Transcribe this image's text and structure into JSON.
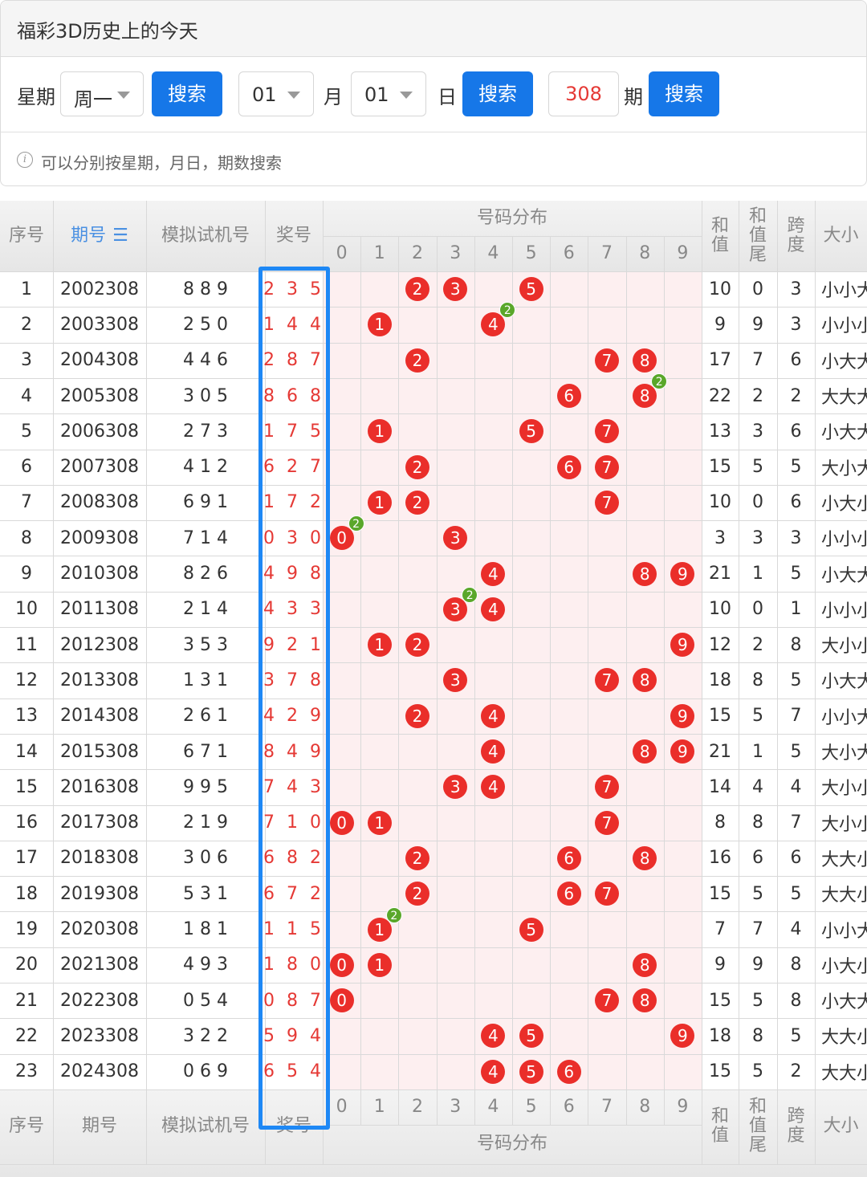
{
  "page": {
    "title": "福彩3D历史上的今天"
  },
  "search": {
    "weekday_label": "星期",
    "weekday_value": "周一",
    "search_button_1": "搜索",
    "month_value": "01",
    "month_label": "月",
    "day_value": "01",
    "day_label": "日",
    "search_button_2": "搜索",
    "issue_value": "308",
    "issue_label": "期",
    "search_button_3": "搜索"
  },
  "hint": "可以分别按星期，月日，期数搜索",
  "table": {
    "headers": {
      "seq": "序号",
      "issue": "期号",
      "trial": "模拟试机号",
      "prize": "奖号",
      "distribution": "号码分布",
      "sum": "和\n值",
      "sum_tail": "和\n值\n尾",
      "span": "跨\n度",
      "size": "大小"
    },
    "digits": [
      "0",
      "1",
      "2",
      "3",
      "4",
      "5",
      "6",
      "7",
      "8",
      "9"
    ],
    "rows": [
      {
        "seq": "1",
        "issue": "2002308",
        "trial": "8 8 9",
        "prize": "2 3 5",
        "sum": "10",
        "tail": "0",
        "span": "3",
        "size": "小小大"
      },
      {
        "seq": "2",
        "issue": "2003308",
        "trial": "2 5 0",
        "prize": "1 4 4",
        "sum": "9",
        "tail": "9",
        "span": "3",
        "size": "小小小"
      },
      {
        "seq": "3",
        "issue": "2004308",
        "trial": "4 4 6",
        "prize": "2 8 7",
        "sum": "17",
        "tail": "7",
        "span": "6",
        "size": "小大大"
      },
      {
        "seq": "4",
        "issue": "2005308",
        "trial": "3 0 5",
        "prize": "8 6 8",
        "sum": "22",
        "tail": "2",
        "span": "2",
        "size": "大大大"
      },
      {
        "seq": "5",
        "issue": "2006308",
        "trial": "2 7 3",
        "prize": "1 7 5",
        "sum": "13",
        "tail": "3",
        "span": "6",
        "size": "小大大"
      },
      {
        "seq": "6",
        "issue": "2007308",
        "trial": "4 1 2",
        "prize": "6 2 7",
        "sum": "15",
        "tail": "5",
        "span": "5",
        "size": "大小大"
      },
      {
        "seq": "7",
        "issue": "2008308",
        "trial": "6 9 1",
        "prize": "1 7 2",
        "sum": "10",
        "tail": "0",
        "span": "6",
        "size": "小大小"
      },
      {
        "seq": "8",
        "issue": "2009308",
        "trial": "7 1 4",
        "prize": "0 3 0",
        "sum": "3",
        "tail": "3",
        "span": "3",
        "size": "小小小"
      },
      {
        "seq": "9",
        "issue": "2010308",
        "trial": "8 2 6",
        "prize": "4 9 8",
        "sum": "21",
        "tail": "1",
        "span": "5",
        "size": "小大大"
      },
      {
        "seq": "10",
        "issue": "2011308",
        "trial": "2 1 4",
        "prize": "4 3 3",
        "sum": "10",
        "tail": "0",
        "span": "1",
        "size": "小小小"
      },
      {
        "seq": "11",
        "issue": "2012308",
        "trial": "3 5 3",
        "prize": "9 2 1",
        "sum": "12",
        "tail": "2",
        "span": "8",
        "size": "大小小"
      },
      {
        "seq": "12",
        "issue": "2013308",
        "trial": "1 3 1",
        "prize": "3 7 8",
        "sum": "18",
        "tail": "8",
        "span": "5",
        "size": "小大大"
      },
      {
        "seq": "13",
        "issue": "2014308",
        "trial": "2 6 1",
        "prize": "4 2 9",
        "sum": "15",
        "tail": "5",
        "span": "7",
        "size": "小小大"
      },
      {
        "seq": "14",
        "issue": "2015308",
        "trial": "6 7 1",
        "prize": "8 4 9",
        "sum": "21",
        "tail": "1",
        "span": "5",
        "size": "大小大"
      },
      {
        "seq": "15",
        "issue": "2016308",
        "trial": "9 9 5",
        "prize": "7 4 3",
        "sum": "14",
        "tail": "4",
        "span": "4",
        "size": "大小小"
      },
      {
        "seq": "16",
        "issue": "2017308",
        "trial": "2 1 9",
        "prize": "7 1 0",
        "sum": "8",
        "tail": "8",
        "span": "7",
        "size": "大小小"
      },
      {
        "seq": "17",
        "issue": "2018308",
        "trial": "3 0 6",
        "prize": "6 8 2",
        "sum": "16",
        "tail": "6",
        "span": "6",
        "size": "大大小"
      },
      {
        "seq": "18",
        "issue": "2019308",
        "trial": "5 3 1",
        "prize": "6 7 2",
        "sum": "15",
        "tail": "5",
        "span": "5",
        "size": "大大小"
      },
      {
        "seq": "19",
        "issue": "2020308",
        "trial": "1 8 1",
        "prize": "1 1 5",
        "sum": "7",
        "tail": "7",
        "span": "4",
        "size": "小小大"
      },
      {
        "seq": "20",
        "issue": "2021308",
        "trial": "4 9 3",
        "prize": "1 8 0",
        "sum": "9",
        "tail": "9",
        "span": "8",
        "size": "小大小"
      },
      {
        "seq": "21",
        "issue": "2022308",
        "trial": "0 5 4",
        "prize": "0 8 7",
        "sum": "15",
        "tail": "5",
        "span": "8",
        "size": "小大大"
      },
      {
        "seq": "22",
        "issue": "2023308",
        "trial": "3 2 2",
        "prize": "5 9 4",
        "sum": "18",
        "tail": "8",
        "span": "5",
        "size": "大大小"
      },
      {
        "seq": "23",
        "issue": "2024308",
        "trial": "0 6 9",
        "prize": "6 5 4",
        "sum": "15",
        "tail": "5",
        "span": "2",
        "size": "大大小"
      }
    ],
    "footer": {
      "seq": "序号",
      "issue": "期号",
      "trial": "模拟试机号",
      "prize": "奖号",
      "distribution": "号码分布",
      "sum": "和\n值",
      "sum_tail": "和\n值\n尾",
      "span": "跨\n度",
      "size": "大小"
    }
  },
  "colors": {
    "accent": "#1677e8",
    "ball": "#ea2e2a",
    "repeat_badge": "#5aa72a",
    "highlight": "#1e88f5",
    "zone": "#fdeff0"
  }
}
